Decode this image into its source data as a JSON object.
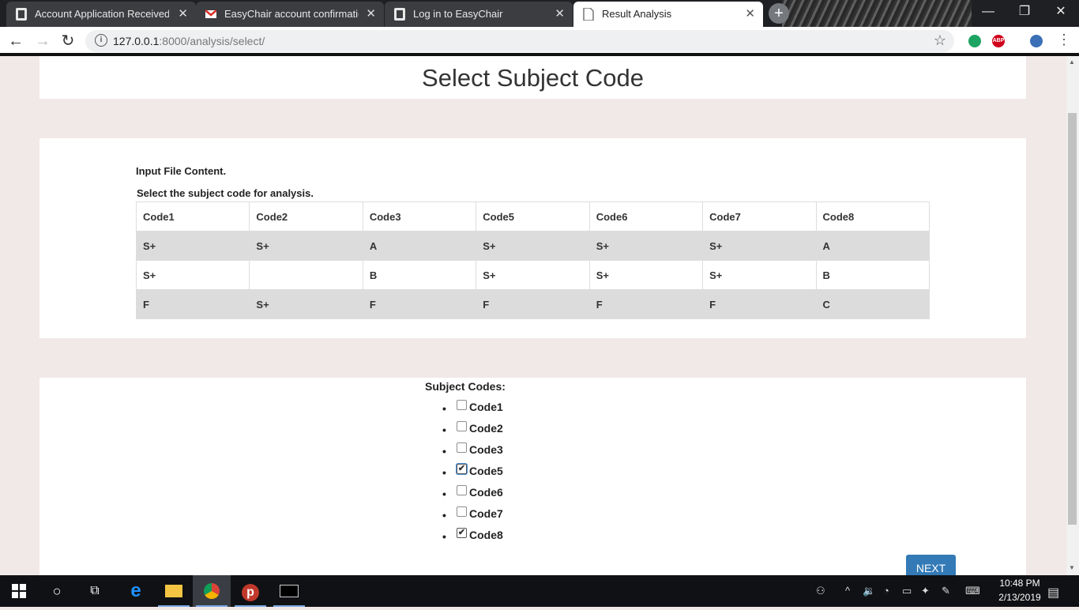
{
  "browser": {
    "tabs": [
      {
        "title": "Account Application Received",
        "icon": "document-icon"
      },
      {
        "title": "EasyChair account confirmation",
        "icon": "gmail-icon"
      },
      {
        "title": "Log in to EasyChair",
        "icon": "document-icon"
      },
      {
        "title": "Result Analysis",
        "icon": "page-icon"
      }
    ],
    "new_tab": "+",
    "url_host": "127.0.0.1",
    "url_path": ":8000/analysis/select/",
    "ext_abp": "ABP"
  },
  "page": {
    "title": "Select Subject Code",
    "input_label": "Input File Content.",
    "select_label": "Select the subject code for analysis.",
    "table": {
      "headers": [
        "Code1",
        "Code2",
        "Code3",
        "Code5",
        "Code6",
        "Code7",
        "Code8"
      ],
      "rows": [
        [
          "S+",
          "S+",
          "A",
          "S+",
          "S+",
          "S+",
          "A"
        ],
        [
          "S+",
          "",
          "B",
          "S+",
          "S+",
          "S+",
          "B"
        ],
        [
          "F",
          "S+",
          "F",
          "F",
          "F",
          "F",
          "C"
        ]
      ]
    },
    "codes_title": "Subject Codes:",
    "codes": [
      {
        "label": "Code1",
        "checked": false
      },
      {
        "label": "Code2",
        "checked": false
      },
      {
        "label": "Code3",
        "checked": false
      },
      {
        "label": "Code5",
        "checked": true
      },
      {
        "label": "Code6",
        "checked": false
      },
      {
        "label": "Code7",
        "checked": false
      },
      {
        "label": "Code8",
        "checked": true
      }
    ],
    "next_label": "NEXT"
  },
  "taskbar": {
    "time": "10:48 PM",
    "date": "2/13/2019"
  }
}
